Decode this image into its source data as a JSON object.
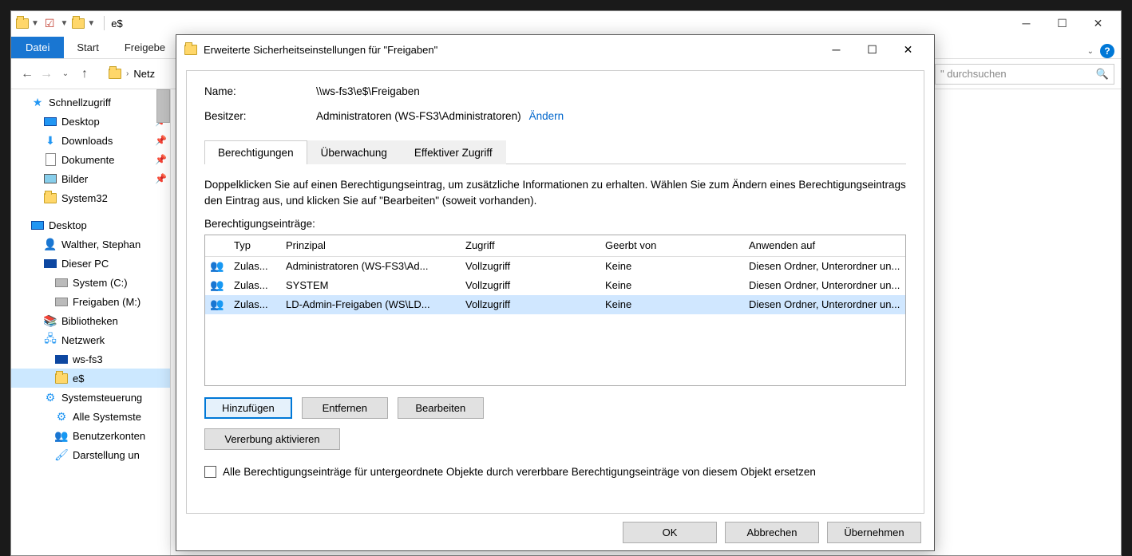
{
  "explorer": {
    "title": "e$",
    "ribbon": {
      "file": "Datei",
      "tabs": [
        "Start",
        "Freigebe"
      ]
    },
    "nav": {
      "crumb": "Netz",
      "search_placeholder": "\" durchsuchen"
    },
    "tree": {
      "quick": "Schnellzugriff",
      "quick_items": [
        {
          "label": "Desktop",
          "pinned": true
        },
        {
          "label": "Downloads",
          "pinned": true
        },
        {
          "label": "Dokumente",
          "pinned": true
        },
        {
          "label": "Bilder",
          "pinned": true
        },
        {
          "label": "System32",
          "pinned": false
        }
      ],
      "desktop": "Desktop",
      "desktop_items": [
        "Walther, Stephan",
        "Dieser PC"
      ],
      "drives": [
        "System (C:)",
        "Freigaben (M:)"
      ],
      "more": [
        "Bibliotheken",
        "Netzwerk"
      ],
      "net_items": [
        "ws-fs3",
        "e$"
      ],
      "cp": "Systemsteuerung",
      "cp_items": [
        "Alle Systemste",
        "Benutzerkonten",
        "Darstellung un"
      ]
    }
  },
  "dialog": {
    "title": "Erweiterte Sicherheitseinstellungen für \"Freigaben\"",
    "name_label": "Name:",
    "name_value": "\\\\ws-fs3\\e$\\Freigaben",
    "owner_label": "Besitzer:",
    "owner_value": "Administratoren (WS-FS3\\Administratoren)",
    "change_link": "Ändern",
    "tabs": [
      "Berechtigungen",
      "Überwachung",
      "Effektiver Zugriff"
    ],
    "hint": "Doppelklicken Sie auf einen Berechtigungseintrag, um zusätzliche Informationen zu erhalten. Wählen Sie zum Ändern eines Berechtigungseintrags den Eintrag aus, und klicken Sie auf \"Bearbeiten\" (soweit vorhanden).",
    "entries_label": "Berechtigungseinträge:",
    "columns": {
      "type": "Typ",
      "principal": "Prinzipal",
      "access": "Zugriff",
      "inherited": "Geerbt von",
      "apply": "Anwenden auf"
    },
    "rows": [
      {
        "type": "Zulas...",
        "principal": "Administratoren (WS-FS3\\Ad...",
        "access": "Vollzugriff",
        "inherited": "Keine",
        "apply": "Diesen Ordner, Unterordner un..."
      },
      {
        "type": "Zulas...",
        "principal": "SYSTEM",
        "access": "Vollzugriff",
        "inherited": "Keine",
        "apply": "Diesen Ordner, Unterordner un..."
      },
      {
        "type": "Zulas...",
        "principal": "LD-Admin-Freigaben (WS\\LD...",
        "access": "Vollzugriff",
        "inherited": "Keine",
        "apply": "Diesen Ordner, Unterordner un..."
      }
    ],
    "buttons": {
      "add": "Hinzufügen",
      "remove": "Entfernen",
      "edit": "Bearbeiten",
      "inherit": "Vererbung aktivieren"
    },
    "replace_check": "Alle Berechtigungseinträge für untergeordnete Objekte durch vererbbare Berechtigungseinträge von diesem Objekt ersetzen",
    "footer": {
      "ok": "OK",
      "cancel": "Abbrechen",
      "apply": "Übernehmen"
    }
  }
}
